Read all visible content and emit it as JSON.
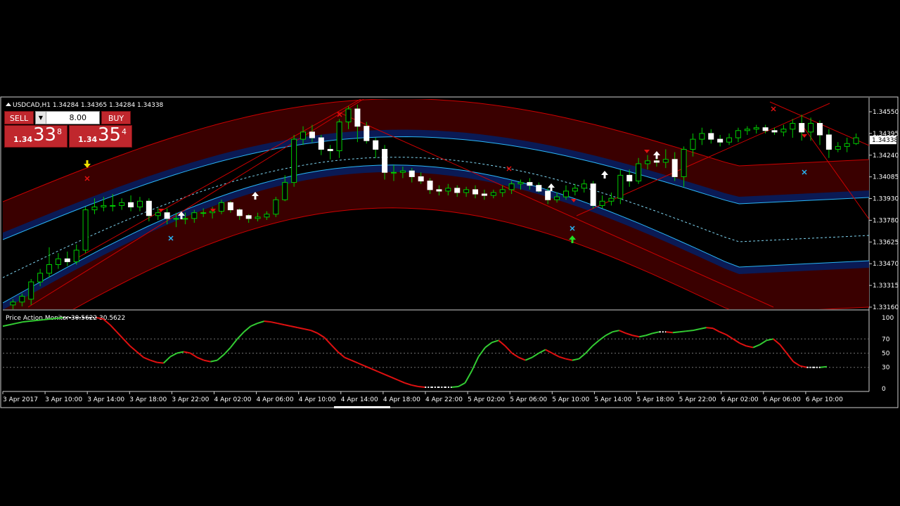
{
  "window": {
    "symbol_info": "USDCAD,H1  1.34284 1.34365 1.34284 1.34338",
    "indicator_info": "Price Action Monitor 30.5622 30.5622"
  },
  "trade_panel": {
    "sell_label": "SELL",
    "buy_label": "BUY",
    "lot": "8.00",
    "sell_prefix": "1.34",
    "sell_big": "33",
    "sell_sup": "8",
    "buy_prefix": "1.34",
    "buy_big": "35",
    "buy_sup": "4"
  },
  "colors": {
    "bull_candle": "#00cc00",
    "bear_candle": "#ffffff",
    "channel_fill": "#3a0000",
    "channel_line": "#cc0000",
    "mid_band": "#0a1a55",
    "mid_band_edge": "#29b6f6",
    "oscillator_up": "#33cc33",
    "oscillator_down": "#e01010",
    "current_price_tag": "#ffffff",
    "grid": "#707070"
  },
  "chart_data": {
    "type": "candlestick",
    "price_axis": {
      "ticks": [
        "1.34550",
        "1.34395",
        "1.34240",
        "1.34085",
        "1.33930",
        "1.33780",
        "1.33625",
        "1.33470",
        "1.33315",
        "1.33160"
      ],
      "current": "1.34338",
      "range": [
        1.3316,
        1.3455
      ]
    },
    "oscillator_axis": {
      "ticks": [
        "100",
        "70",
        "50",
        "30",
        "0"
      ],
      "range": [
        0,
        100
      ]
    },
    "time_labels": [
      "3 Apr 2017",
      "3 Apr 10:00",
      "3 Apr 14:00",
      "3 Apr 18:00",
      "3 Apr 22:00",
      "4 Apr 02:00",
      "4 Apr 06:00",
      "4 Apr 10:00",
      "4 Apr 14:00",
      "4 Apr 18:00",
      "4 Apr 22:00",
      "5 Apr 02:00",
      "5 Apr 06:00",
      "5 Apr 10:00",
      "5 Apr 14:00",
      "5 Apr 18:00",
      "5 Apr 22:00",
      "6 Apr 02:00",
      "6 Apr 06:00",
      "6 Apr 10:00"
    ],
    "candles": [
      [
        1.3318,
        1.332,
        1.3315,
        1.3322
      ],
      [
        1.332,
        1.3324,
        1.3317,
        1.3326
      ],
      [
        1.3322,
        1.3334,
        1.3318,
        1.3336
      ],
      [
        1.3334,
        1.334,
        1.3331,
        1.3343
      ],
      [
        1.334,
        1.3346,
        1.3337,
        1.3358
      ],
      [
        1.3346,
        1.335,
        1.3343,
        1.3354
      ],
      [
        1.335,
        1.3348,
        1.3345,
        1.3355
      ],
      [
        1.3348,
        1.3356,
        1.3346,
        1.336
      ],
      [
        1.3356,
        1.3384,
        1.3354,
        1.3386
      ],
      [
        1.3384,
        1.3386,
        1.3381,
        1.3392
      ],
      [
        1.3386,
        1.3387,
        1.3383,
        1.3393
      ],
      [
        1.3387,
        1.3387,
        1.3383,
        1.3395
      ],
      [
        1.3387,
        1.3389,
        1.3384,
        1.3392
      ],
      [
        1.3389,
        1.3386,
        1.3383,
        1.3394
      ],
      [
        1.3386,
        1.339,
        1.3383,
        1.3393
      ],
      [
        1.339,
        1.338,
        1.3376,
        1.3392
      ],
      [
        1.338,
        1.3382,
        1.3377,
        1.3385
      ],
      [
        1.3382,
        1.3378,
        1.3374,
        1.3385
      ],
      [
        1.3378,
        1.3378,
        1.3372,
        1.3382
      ],
      [
        1.3378,
        1.3378,
        1.3374,
        1.3382
      ],
      [
        1.3378,
        1.3382,
        1.3375,
        1.3384
      ],
      [
        1.3382,
        1.3382,
        1.3379,
        1.3385
      ],
      [
        1.3382,
        1.3383,
        1.3378,
        1.3386
      ],
      [
        1.3383,
        1.3389,
        1.3381,
        1.3391
      ],
      [
        1.3389,
        1.3384,
        1.3382,
        1.339
      ],
      [
        1.3384,
        1.338,
        1.3377,
        1.3385
      ],
      [
        1.338,
        1.3378,
        1.3375,
        1.3381
      ],
      [
        1.3378,
        1.3379,
        1.3376,
        1.3382
      ],
      [
        1.3379,
        1.3381,
        1.3377,
        1.3383
      ],
      [
        1.3381,
        1.3391,
        1.3379,
        1.3393
      ],
      [
        1.3391,
        1.3403,
        1.339,
        1.3408
      ],
      [
        1.3403,
        1.3433,
        1.34,
        1.3436
      ],
      [
        1.3433,
        1.3438,
        1.3429,
        1.3442
      ],
      [
        1.3438,
        1.3434,
        1.3431,
        1.3443
      ],
      [
        1.3434,
        1.3426,
        1.3422,
        1.3436
      ],
      [
        1.3426,
        1.3425,
        1.3419,
        1.3429
      ],
      [
        1.3425,
        1.3445,
        1.342,
        1.3447
      ],
      [
        1.3445,
        1.3454,
        1.344,
        1.3456
      ],
      [
        1.3454,
        1.3442,
        1.3431,
        1.3457
      ],
      [
        1.3442,
        1.3432,
        1.343,
        1.3445
      ],
      [
        1.3432,
        1.3426,
        1.342,
        1.3434
      ],
      [
        1.3426,
        1.341,
        1.3405,
        1.3429
      ],
      [
        1.341,
        1.341,
        1.3404,
        1.3415
      ],
      [
        1.341,
        1.3411,
        1.3406,
        1.3414
      ],
      [
        1.3411,
        1.3407,
        1.3403,
        1.3413
      ],
      [
        1.3407,
        1.3404,
        1.3402,
        1.341
      ],
      [
        1.3404,
        1.3398,
        1.3395,
        1.3406
      ],
      [
        1.3398,
        1.3397,
        1.3394,
        1.3401
      ],
      [
        1.3397,
        1.3399,
        1.3394,
        1.3402
      ],
      [
        1.3399,
        1.3396,
        1.3393,
        1.3401
      ],
      [
        1.3396,
        1.3398,
        1.3393,
        1.34
      ],
      [
        1.3398,
        1.3395,
        1.3392,
        1.3401
      ],
      [
        1.3395,
        1.3394,
        1.3391,
        1.3398
      ],
      [
        1.3394,
        1.3396,
        1.3392,
        1.3398
      ],
      [
        1.3396,
        1.3398,
        1.3393,
        1.3401
      ],
      [
        1.3398,
        1.3402,
        1.3395,
        1.3404
      ],
      [
        1.3402,
        1.3403,
        1.3398,
        1.3405
      ],
      [
        1.3403,
        1.3401,
        1.3398,
        1.3406
      ],
      [
        1.3401,
        1.3397,
        1.3396,
        1.3403
      ],
      [
        1.3397,
        1.3391,
        1.3388,
        1.3399
      ],
      [
        1.3391,
        1.3393,
        1.3389,
        1.3396
      ],
      [
        1.3393,
        1.3397,
        1.3391,
        1.3401
      ],
      [
        1.3397,
        1.3399,
        1.3394,
        1.3402
      ],
      [
        1.3399,
        1.3402,
        1.3396,
        1.3405
      ],
      [
        1.3402,
        1.3387,
        1.3385,
        1.3404
      ],
      [
        1.3387,
        1.339,
        1.3385,
        1.3394
      ],
      [
        1.339,
        1.3392,
        1.3387,
        1.3396
      ],
      [
        1.3392,
        1.3408,
        1.3388,
        1.3412
      ],
      [
        1.3408,
        1.3404,
        1.34,
        1.3412
      ],
      [
        1.3404,
        1.3416,
        1.3402,
        1.342
      ],
      [
        1.3416,
        1.3418,
        1.3412,
        1.3422
      ],
      [
        1.3418,
        1.3417,
        1.3414,
        1.3424
      ],
      [
        1.3417,
        1.3419,
        1.3413,
        1.3426
      ],
      [
        1.3419,
        1.3407,
        1.3404,
        1.3424
      ],
      [
        1.3407,
        1.3426,
        1.34,
        1.3428
      ],
      [
        1.3426,
        1.3433,
        1.3421,
        1.3437
      ],
      [
        1.3433,
        1.3437,
        1.3429,
        1.3441
      ],
      [
        1.3437,
        1.3433,
        1.343,
        1.344
      ],
      [
        1.3433,
        1.3431,
        1.3428,
        1.3436
      ],
      [
        1.3431,
        1.3434,
        1.3429,
        1.3437
      ],
      [
        1.3434,
        1.3439,
        1.3431,
        1.3441
      ],
      [
        1.3439,
        1.344,
        1.3436,
        1.3442
      ],
      [
        1.344,
        1.3441,
        1.3437,
        1.3443
      ],
      [
        1.3441,
        1.3439,
        1.3437,
        1.3443
      ],
      [
        1.3439,
        1.3438,
        1.3436,
        1.3441
      ],
      [
        1.3438,
        1.344,
        1.3435,
        1.3443
      ],
      [
        1.344,
        1.3444,
        1.3434,
        1.3447
      ],
      [
        1.3444,
        1.3438,
        1.3432,
        1.345
      ],
      [
        1.3438,
        1.3444,
        1.3432,
        1.3448
      ],
      [
        1.3444,
        1.3436,
        1.3429,
        1.3446
      ],
      [
        1.3436,
        1.3426,
        1.342,
        1.344
      ],
      [
        1.3426,
        1.3428,
        1.3424,
        1.3431
      ],
      [
        1.3428,
        1.343,
        1.3424,
        1.3434
      ],
      [
        1.343,
        1.3434,
        1.3429,
        1.3437
      ]
    ],
    "oscillator": [
      88,
      90,
      92,
      94,
      95,
      96,
      97,
      98,
      99,
      100,
      100,
      100,
      100,
      100,
      100,
      98,
      90,
      80,
      70,
      60,
      52,
      44,
      40,
      37,
      36,
      45,
      50,
      52,
      50,
      44,
      40,
      38,
      40,
      48,
      58,
      70,
      80,
      88,
      92,
      95,
      94,
      92,
      90,
      88,
      86,
      84,
      82,
      78,
      72,
      62,
      52,
      44,
      40,
      36,
      32,
      28,
      24,
      20,
      16,
      12,
      8,
      5,
      3,
      2,
      2,
      2,
      2,
      2,
      3,
      8,
      25,
      45,
      58,
      65,
      68,
      60,
      50,
      44,
      40,
      44,
      50,
      55,
      50,
      45,
      42,
      40,
      42,
      50,
      60,
      68,
      75,
      80,
      82,
      78,
      75,
      73,
      75,
      78,
      80,
      80,
      79,
      80,
      81,
      82,
      84,
      86,
      85,
      80,
      76,
      70,
      64,
      60,
      58,
      62,
      68,
      70,
      62,
      50,
      38,
      32,
      30,
      30,
      30,
      31
    ]
  }
}
